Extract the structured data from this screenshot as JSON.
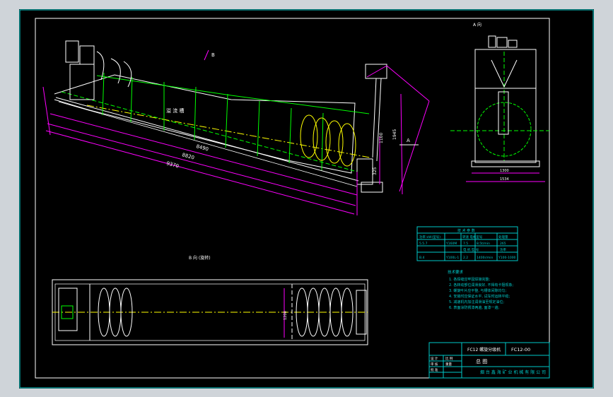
{
  "drawing": {
    "view_a_label": "A 向",
    "view_b_label": "B 向 (旋转)",
    "b_marker": "B",
    "a_marker": "A",
    "tank_label": "溢 流 槽",
    "dim_main_1": "8490",
    "dim_main_2": "8820",
    "dim_main_3": "9370",
    "dim_side_1": "1100",
    "dim_side_2": "1945",
    "dim_side_3": "325",
    "dim_front_1": "1300",
    "dim_front_2": "1534",
    "dim_plan_width": "1200"
  },
  "param_table": {
    "title": "技 术 参 数",
    "col1_header": "功率 kW(型号)",
    "col2_header": "转速 电机型号",
    "col3_header": "处理量",
    "rows": [
      {
        "a": "5.5.7",
        "b": "Y160M",
        "c": "7.5",
        "d": "8.5t/min",
        "e": "265"
      },
      {
        "a": "电 机 型 号",
        "b": "",
        "c": "功率",
        "d": "",
        "e": ""
      },
      {
        "a": "B.4",
        "b": "Y100L-1",
        "c": "2.2",
        "d": "1400r/min",
        "e": "Y100-1000"
      }
    ]
  },
  "tech_requirements": {
    "title": "技术要求",
    "items": [
      "1. 各焊缝应牢固焊接完整;",
      "2. 各转动部位润滑良好, 不得有卡阻现象;",
      "3. 螺旋叶片应平整, 与槽体间隙均匀;",
      "4. 安装时应保证水平, 试车时运转平稳;",
      "5. 减速机内加注润滑油至规定油位;",
      "6. 表面涂防锈漆两遍, 面漆一遍;"
    ]
  },
  "title_block": {
    "product_name": "FC12 螺旋分级机",
    "drawing_no": "FC12-00",
    "drawing_title": "总 图",
    "company": "烟 台 鑫 海 矿 业 机 械 有 限 公 司",
    "cell_scale_label": "比 例",
    "cell_weight_label": "重量",
    "row_labels": [
      "设 计",
      "审 核",
      "批 准"
    ]
  },
  "colors": {
    "frame_line": "#00d8d8",
    "outline": "#ffffff",
    "green": "#00ff00",
    "yellow": "#ffff00",
    "magenta": "#ff00ff",
    "cyan": "#00ffff",
    "table_line": "#00c8c8"
  }
}
